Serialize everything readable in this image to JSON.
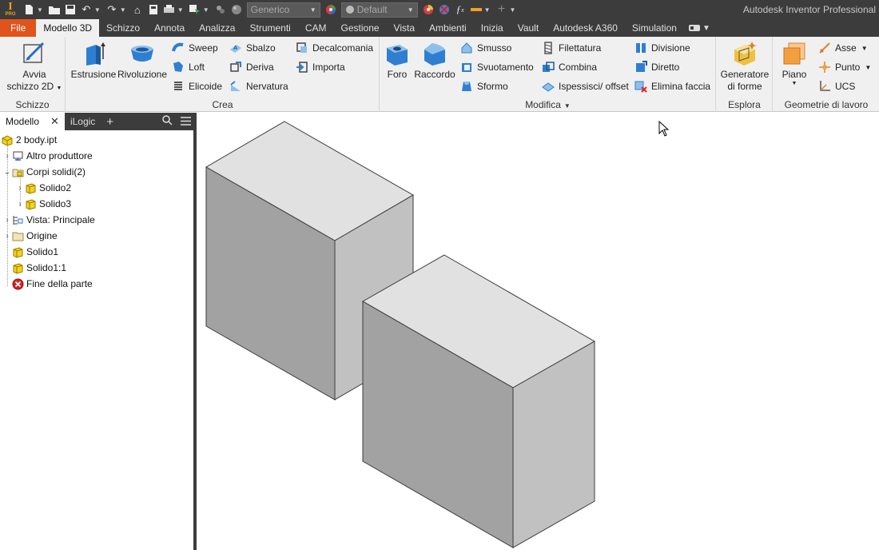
{
  "app": {
    "title": "Autodesk Inventor Professional"
  },
  "quick_access": {
    "material_combo": "Generico",
    "appearance_combo": "Default"
  },
  "tabs": [
    {
      "label": "File"
    },
    {
      "label": "Modello 3D"
    },
    {
      "label": "Schizzo"
    },
    {
      "label": "Annota"
    },
    {
      "label": "Analizza"
    },
    {
      "label": "Strumenti"
    },
    {
      "label": "CAM"
    },
    {
      "label": "Gestione"
    },
    {
      "label": "Vista"
    },
    {
      "label": "Ambienti"
    },
    {
      "label": "Inizia"
    },
    {
      "label": "Vault"
    },
    {
      "label": "Autodesk A360"
    },
    {
      "label": "Simulation"
    }
  ],
  "ribbon": {
    "schizzo": {
      "label": "Schizzo",
      "start_sketch_line1": "Avvia",
      "start_sketch_line2": "schizzo 2D"
    },
    "crea": {
      "label": "Crea",
      "estrusione": "Estrusione",
      "rivoluzione": "Rivoluzione",
      "sweep": "Sweep",
      "loft": "Loft",
      "elicoide": "Elicoide",
      "sbalzo": "Sbalzo",
      "deriva": "Deriva",
      "nervatura": "Nervatura",
      "decalcomania": "Decalcomania",
      "importa": "Importa"
    },
    "modifica": {
      "label": "Modifica",
      "foro": "Foro",
      "raccordo": "Raccordo",
      "smusso": "Smusso",
      "svuotamento": "Svuotamento",
      "sformo": "Sformo",
      "filettatura": "Filettatura",
      "combina": "Combina",
      "ispessisci": "Ispessisci/ offset",
      "divisione": "Divisione",
      "diretto": "Diretto",
      "elimina_faccia": "Elimina faccia"
    },
    "esplora": {
      "label": "Esplora",
      "generatore_line1": "Generatore",
      "generatore_line2": "di forme"
    },
    "geometrie": {
      "label": "Geometrie di lavoro",
      "piano": "Piano",
      "asse": "Asse",
      "punto": "Punto",
      "ucs": "UCS"
    }
  },
  "browser": {
    "tabs": [
      {
        "label": "Modello"
      },
      {
        "label": "iLogic"
      }
    ],
    "tree": [
      {
        "label": "2 body.ipt"
      },
      {
        "label": "Altro produttore"
      },
      {
        "label": "Corpi solidi(2)"
      },
      {
        "label": "Solido2"
      },
      {
        "label": "Solido3"
      },
      {
        "label": "Vista: Principale"
      },
      {
        "label": "Origine"
      },
      {
        "label": "Solido1"
      },
      {
        "label": "Solido1:1"
      },
      {
        "label": "Fine della parte"
      }
    ]
  },
  "colors": {
    "file_tab": "#e0541c",
    "dark_chrome": "#3c3c3c",
    "box_top": "#e1e1e1",
    "box_left": "#a2a2a2",
    "box_right": "#c1c1c1",
    "solid_icon": "#f5d21f"
  }
}
